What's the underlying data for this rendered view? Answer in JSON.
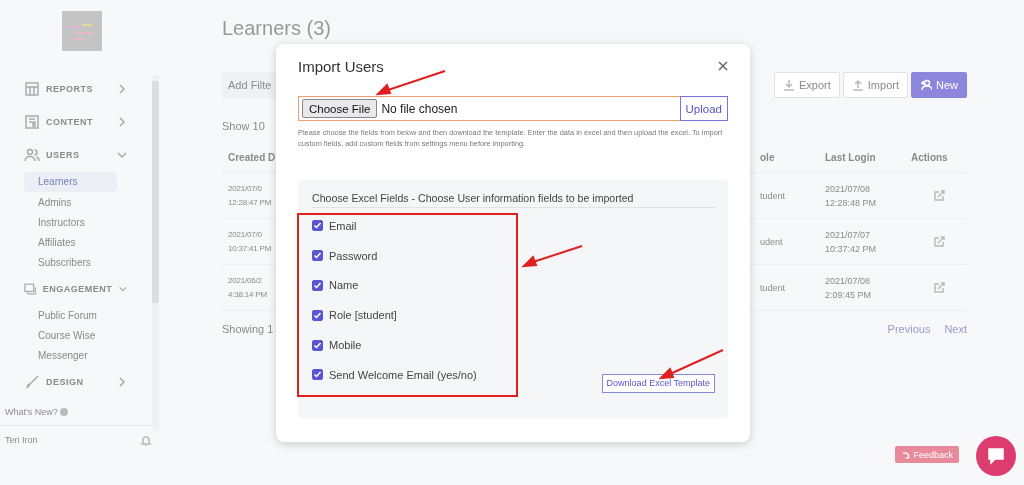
{
  "sidebar": {
    "sections": [
      {
        "label": "REPORTS",
        "expanded": false
      },
      {
        "label": "CONTENT",
        "expanded": false
      },
      {
        "label": "USERS",
        "expanded": true,
        "children": [
          {
            "label": "Learners",
            "selected": true
          },
          {
            "label": "Admins",
            "selected": false
          },
          {
            "label": "Instructors",
            "selected": false
          },
          {
            "label": "Affiliates",
            "selected": false
          },
          {
            "label": "Subscribers",
            "selected": false
          }
        ]
      },
      {
        "label": "ENGAGEMENT",
        "expanded": true,
        "children": [
          {
            "label": "Public Forum",
            "selected": false
          },
          {
            "label": "Course Wise",
            "selected": false
          },
          {
            "label": "Messenger",
            "selected": false
          }
        ]
      },
      {
        "label": "DESIGN",
        "expanded": false
      }
    ],
    "whats_new": "What's New?",
    "user_name": "Teri Iron"
  },
  "page": {
    "title": "Learners (3)",
    "filter_placeholder": "Add Filte",
    "buttons": [
      {
        "label": "Export",
        "kind": "export"
      },
      {
        "label": "Import",
        "kind": "import"
      },
      {
        "label": "New",
        "kind": "new"
      }
    ],
    "show": "Show 10",
    "table": {
      "columns": [
        "Created D",
        "ole",
        "Last Login",
        "Actions"
      ],
      "rows": [
        {
          "created": [
            "2021/07/0",
            "12:28:47 PM"
          ],
          "role": "tudent",
          "last_login": [
            "2021/07/08",
            "12:28:48 PM"
          ]
        },
        {
          "created": [
            "2021/07/0",
            "10:37:41 PM"
          ],
          "role": "udent",
          "last_login": [
            "2021/07/07",
            "10:37:42 PM"
          ]
        },
        {
          "created": [
            "2021/06/2",
            "4:38:14 PM"
          ],
          "role": "tudent",
          "last_login": [
            "2021/07/08",
            "2:09:45 PM"
          ]
        }
      ]
    },
    "showing": "Showing 1",
    "pagination": [
      "Previous",
      "Next"
    ]
  },
  "feedback": "Feedback",
  "modal": {
    "title": "Import Users",
    "file_button": "Choose File",
    "file_status": "No file chosen",
    "upload": "Upload",
    "help": "Please choose the fields from below and then download the template. Enter the data in excel and then upload the excel. To import custom fields, add custom fields from settings menu before importing.",
    "fields_title": "Choose Excel Fields - Choose User information fields to be imported",
    "fields": [
      {
        "label": "Email",
        "checked": true
      },
      {
        "label": "Password",
        "checked": true
      },
      {
        "label": "Name",
        "checked": true
      },
      {
        "label": "Role [student]",
        "checked": true
      },
      {
        "label": "Mobile",
        "checked": true
      },
      {
        "label": "Send Welcome Email (yes/no)",
        "checked": true
      }
    ],
    "download": "Download Excel Template"
  }
}
